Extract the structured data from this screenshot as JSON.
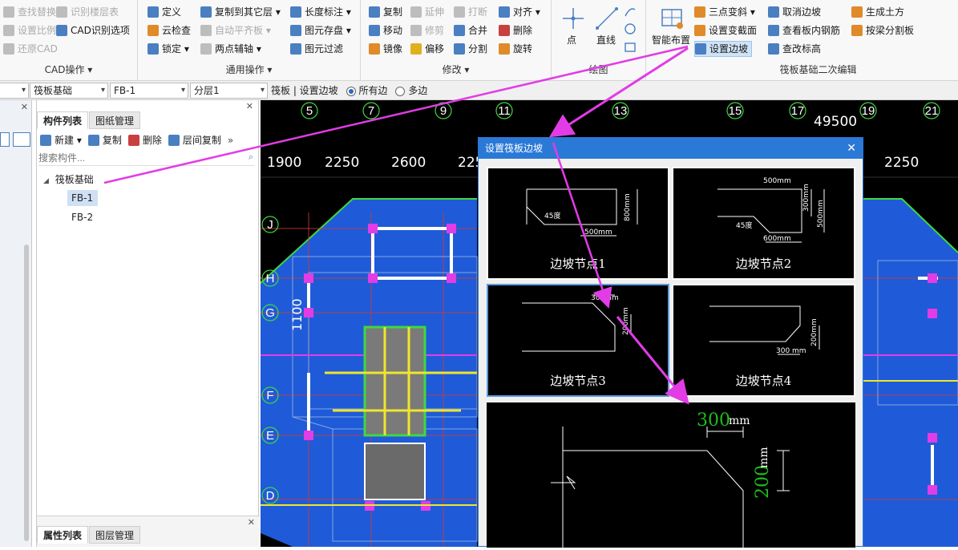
{
  "ribbon": {
    "groups": [
      {
        "title": "CAD操作 ▾",
        "items": [
          "查找替换",
          "识别楼层表",
          "设置比例",
          "CAD识别选项",
          "还原CAD"
        ]
      },
      {
        "title": "通用操作 ▾",
        "items": [
          "定义",
          "复制到其它层 ▾",
          "长度标注 ▾",
          "云检查",
          "自动平齐板 ▾",
          "图元存盘 ▾",
          "锁定 ▾",
          "两点辅轴 ▾",
          "图元过滤"
        ]
      },
      {
        "title": "修改 ▾",
        "items": [
          "复制",
          "延伸",
          "打断",
          "对齐 ▾",
          "移动",
          "修剪",
          "合并",
          "删除",
          "镜像",
          "偏移",
          "分割",
          "旋转"
        ]
      },
      {
        "title": "绘图",
        "items": [
          "点",
          "直线"
        ]
      },
      {
        "title": "筏板基础二次编辑",
        "items": [
          "智能布置",
          "三点变斜 ▾",
          "设置变截面",
          "设置边坡",
          "取消边坡",
          "查看板内钢筋",
          "查改标高",
          "生成土方",
          "按梁分割板"
        ]
      }
    ]
  },
  "propbar": {
    "dd1": "筏板基础",
    "dd2": "FB-1",
    "dd3": "分层1",
    "label": "筏板 | 设置边坡",
    "radio1": "所有边",
    "radio2": "多边"
  },
  "component_panel": {
    "tab_active": "构件列表",
    "tab_other": "图纸管理",
    "toolbar": {
      "new": "新建 ▾",
      "copy": "复制",
      "delete": "删除",
      "floor_copy": "层间复制"
    },
    "search_placeholder": "搜索构件...",
    "tree_root": "筏板基础",
    "items": [
      "FB-1",
      "FB-2"
    ],
    "prop_tab_active": "属性列表",
    "prop_tab_other": "图层管理"
  },
  "canvas": {
    "axis_top": [
      "5",
      "7",
      "9",
      "11",
      "13",
      "15",
      "17",
      "19",
      "21"
    ],
    "axis_left": [
      "J",
      "H",
      "G",
      "F",
      "E",
      "D"
    ],
    "dims": [
      "1900",
      "2250",
      "2600",
      "225",
      "2250"
    ],
    "total": "49500",
    "side_dim": "1100"
  },
  "dialog": {
    "title": "设置筏板边坡",
    "options": [
      {
        "label": "边坡节点1",
        "t1": "45度",
        "t2": "800mm",
        "t3": "500mm"
      },
      {
        "label": "边坡节点2",
        "t1": "500mm",
        "t2": "300mm",
        "t3": "45度",
        "t4": "600mm",
        "t5": "500mm"
      },
      {
        "label": "边坡节点3",
        "t1": "300mm",
        "t2": "200mm"
      },
      {
        "label": "边坡节点4",
        "t1": "300 mm",
        "t2": "200mm"
      }
    ],
    "preview": {
      "w": "300",
      "w_unit": "mm",
      "h": "200",
      "h_unit": "mm"
    }
  },
  "colors": {
    "accent": "#2b79d6",
    "canvas_blue": "#1f5bd8",
    "annotation": "#e23ce6",
    "green_text": "#19c019"
  }
}
